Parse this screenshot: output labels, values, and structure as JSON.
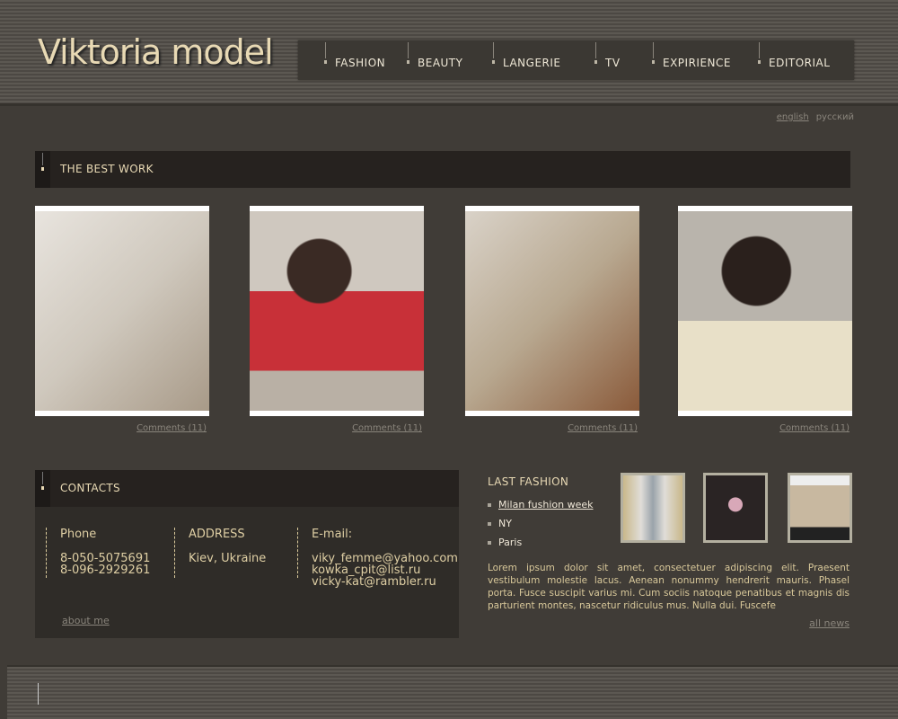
{
  "header": {
    "logo": "Viktoria model",
    "nav": [
      "FASHION",
      "BEAUTY",
      "LANGERIE",
      "TV",
      "EXPIRIENCE",
      "EDITORIAL"
    ]
  },
  "languages": {
    "english": "english",
    "russian": "русский"
  },
  "best_work": {
    "title": "THE BEST WORK",
    "photos": [
      {
        "comments": "Comments (11)"
      },
      {
        "comments": "Comments (11)"
      },
      {
        "comments": "Comments (11)"
      },
      {
        "comments": "Comments (11)"
      }
    ]
  },
  "contacts": {
    "title": "CONTACTS",
    "phone_label": "Phone",
    "phones": [
      "8-050-5075691",
      "8-096-2929261"
    ],
    "address_label": "ADDRESS",
    "address": "Kiev, Ukraine",
    "email_label": "E-mail:",
    "emails": [
      "viky_femme@yahoo.com",
      "kowka_cpit@list.ru",
      "vicky-kat@rambler.ru"
    ],
    "about": "about me"
  },
  "last_fashion": {
    "title": "LAST FASHION",
    "items": [
      "Milan fushion week",
      "NY",
      "Paris"
    ],
    "text": "Lorem ipsum dolor sit amet, consectetuer adipiscing elit. Praesent vestibulum molestie lacus. Aenean nonummy hendrerit mauris. Phasel porta. Fusce suscipit varius mi. Cum sociis natoque penatibus et magnis dis parturient montes, nascetur ridiculus mus. Nulla dui. Fuscefe",
    "all_news": "all news"
  },
  "colors": {
    "accent": "#e8d9b4",
    "background": "#403c37",
    "bar": "#26221f"
  }
}
